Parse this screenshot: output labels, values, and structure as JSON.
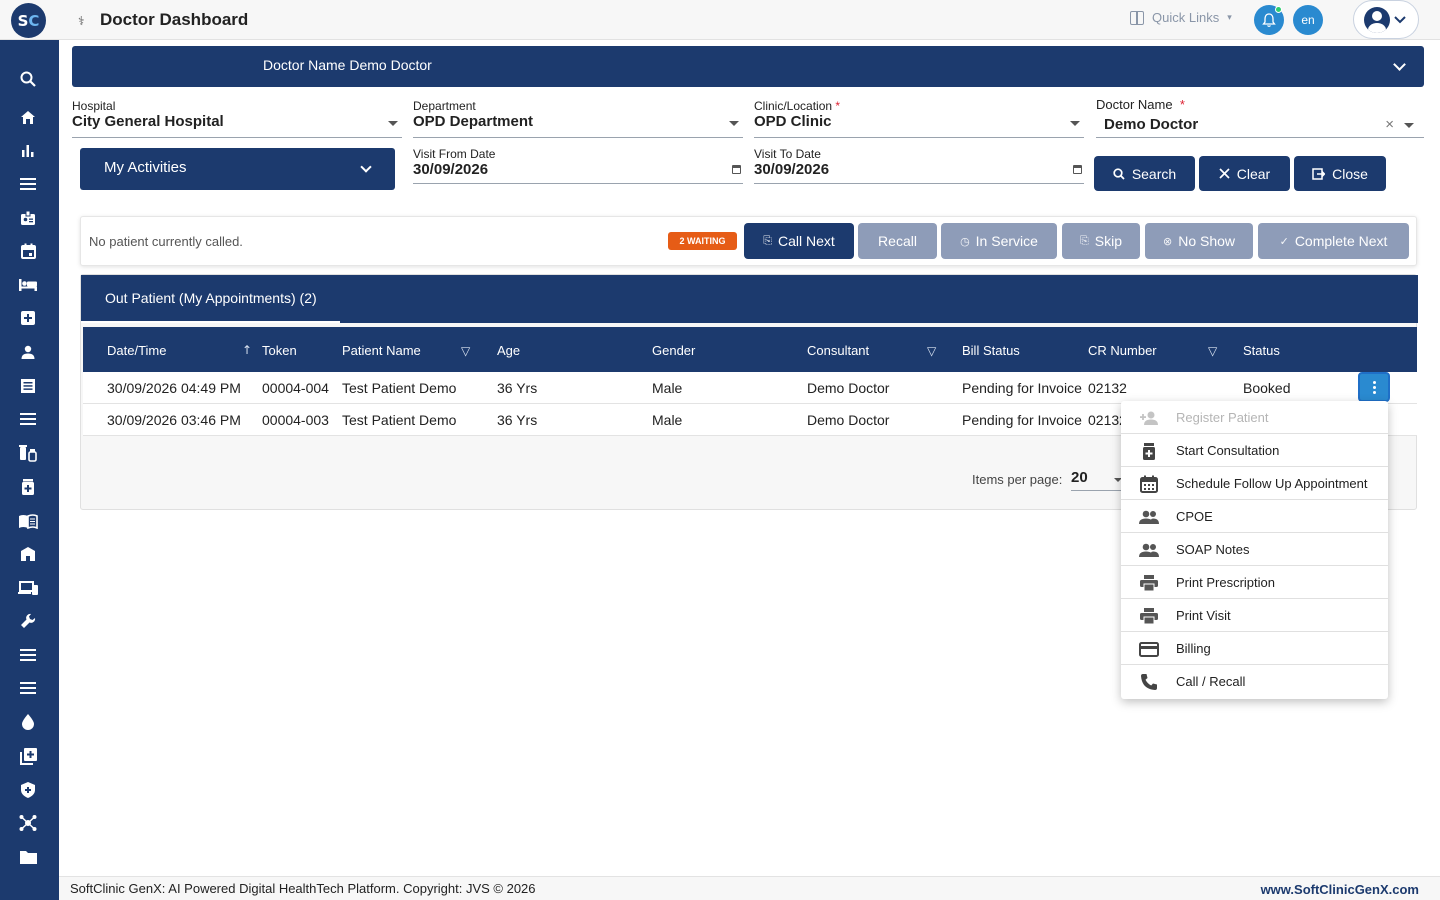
{
  "app": {
    "logo_s": "S",
    "logo_c": "C",
    "title": "Doctor Dashboard"
  },
  "topbar": {
    "quick_links": "Quick Links",
    "language": "en",
    "bell_color": "#2a8ad0",
    "status_dot_color": "#2ecc71"
  },
  "sidebar": {
    "icons": [
      "search-icon",
      "home-icon",
      "bar-chart-icon",
      "menu-icon",
      "badge-icon",
      "calendar-icon",
      "bed-icon",
      "medical-plus-icon",
      "person-icon",
      "receipt-icon",
      "list-icon",
      "vaccine-icon",
      "pharmacy-icon",
      "book-icon",
      "building-icon",
      "devices-icon",
      "wrench-icon",
      "list-icon-2",
      "list-icon-3",
      "blood-drop-icon",
      "add-box-icon",
      "shield-icon",
      "hub-icon",
      "folder-icon"
    ]
  },
  "doctor_header": {
    "text": "Doctor Name Demo Doctor"
  },
  "filters": {
    "hospital": {
      "label": "Hospital",
      "value": "City General Hospital"
    },
    "department": {
      "label": "Department",
      "value": "OPD Department"
    },
    "clinic": {
      "label": "Clinic/Location",
      "required": "*",
      "value": "OPD Clinic"
    },
    "doctor": {
      "label": "Doctor Name",
      "required": "*",
      "value": "Demo Doctor",
      "clear": "×"
    },
    "my_activities": "My Activities",
    "visit_from": {
      "label": "Visit From Date",
      "value": "30/09/2026"
    },
    "visit_to": {
      "label": "Visit To Date",
      "value": "30/09/2026"
    },
    "search_label": "Search",
    "clear_label": "Clear",
    "close_label": "Close"
  },
  "queue": {
    "status_text": "No patient currently called.",
    "waiting_badge": "2 WAITING",
    "call_next": "Call Next",
    "recall": "Recall",
    "in_service": "In Service",
    "skip": "Skip",
    "no_show": "No Show",
    "complete_next": "Complete Next",
    "waiting_color": "#e65c16"
  },
  "out_patient": {
    "tab_label": "Out Patient (My Appointments) (2)",
    "columns": [
      "Date/Time",
      "Token",
      "Patient Name",
      "Age",
      "Gender",
      "Consultant",
      "Bill Status",
      "CR Number",
      "Status"
    ],
    "rows": [
      [
        "30/09/2026 04:49 PM",
        "00004-004",
        "Test Patient Demo",
        "36 Yrs",
        "Male",
        "Demo Doctor",
        "Pending for Invoice",
        "02132",
        "Booked"
      ],
      [
        "30/09/2026 03:46 PM",
        "00004-003",
        "Test Patient Demo",
        "36 Yrs",
        "Male",
        "Demo Doctor",
        "Pending for Invoice",
        "02132",
        ""
      ]
    ],
    "items_per_page_label": "Items per page:",
    "items_per_page_value": "20"
  },
  "context_menu": {
    "items": [
      {
        "label": "Register Patient",
        "icon": "person-add-icon",
        "disabled": true
      },
      {
        "label": "Start Consultation",
        "icon": "medical-bag-icon",
        "disabled": false
      },
      {
        "label": "Schedule Follow Up Appointment",
        "icon": "calendar-icon",
        "disabled": false
      },
      {
        "label": "CPOE",
        "icon": "people-icon",
        "disabled": false
      },
      {
        "label": "SOAP Notes",
        "icon": "people-icon",
        "disabled": false
      },
      {
        "label": "Print Prescription",
        "icon": "print-icon",
        "disabled": false
      },
      {
        "label": "Print Visit",
        "icon": "print-icon",
        "disabled": false
      },
      {
        "label": "Billing",
        "icon": "credit-card-icon",
        "disabled": false
      },
      {
        "label": "Call / Recall",
        "icon": "phone-icon",
        "disabled": false
      }
    ]
  },
  "footer": {
    "copyright": "SoftClinic GenX: AI Powered Digital HealthTech Platform. Copyright: JVS © 2026",
    "website": "www.SoftClinicGenX.com"
  },
  "colors": {
    "primary": "#1c3a6e",
    "accent": "#2a8ad0",
    "disabled_button": "#8e9cb8"
  }
}
